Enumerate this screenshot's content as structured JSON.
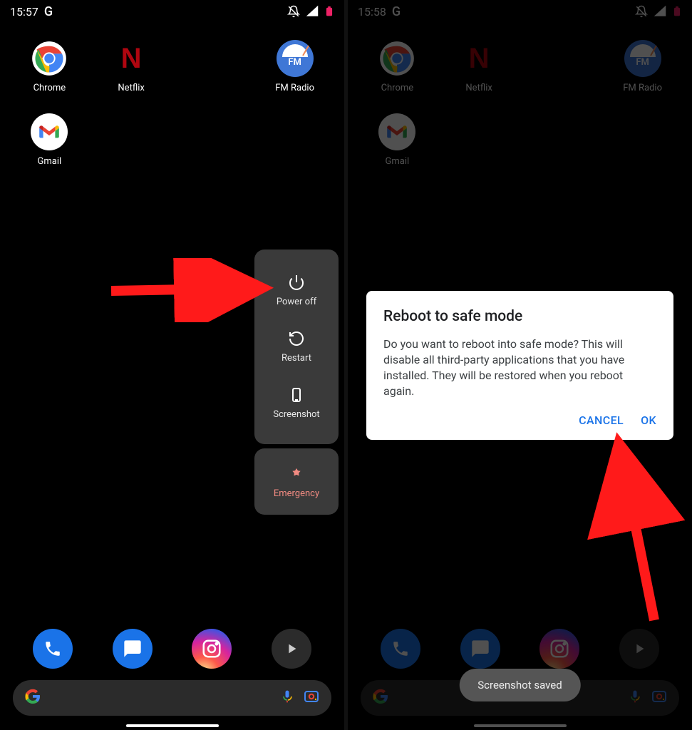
{
  "left": {
    "status": {
      "time": "15:57",
      "logo": "G"
    },
    "apps": {
      "row1": [
        {
          "icon": "chrome",
          "label": "Chrome"
        },
        {
          "icon": "netflix",
          "label": "Netflix",
          "letter": "N"
        },
        {
          "icon": "spacer",
          "label": ""
        },
        {
          "icon": "fmradio",
          "label": "FM Radio",
          "text": "FM"
        }
      ],
      "row2": [
        {
          "icon": "gmail",
          "label": "Gmail"
        }
      ]
    },
    "power_menu": {
      "items": [
        {
          "id": "power-off",
          "label": "Power off"
        },
        {
          "id": "restart",
          "label": "Restart"
        },
        {
          "id": "screenshot",
          "label": "Screenshot"
        }
      ],
      "emergency": {
        "label": "Emergency"
      }
    }
  },
  "right": {
    "status": {
      "time": "15:58",
      "logo": "G"
    },
    "dialog": {
      "title": "Reboot to safe mode",
      "body": "Do you want to reboot into safe mode? This will disable all third-party applications that you have installed. They will be restored when you reboot again.",
      "cancel": "CANCEL",
      "ok": "OK"
    },
    "toast": "Screenshot saved"
  },
  "icons": {
    "mute": "🔕",
    "signal": "📶",
    "battery": "🔋"
  }
}
